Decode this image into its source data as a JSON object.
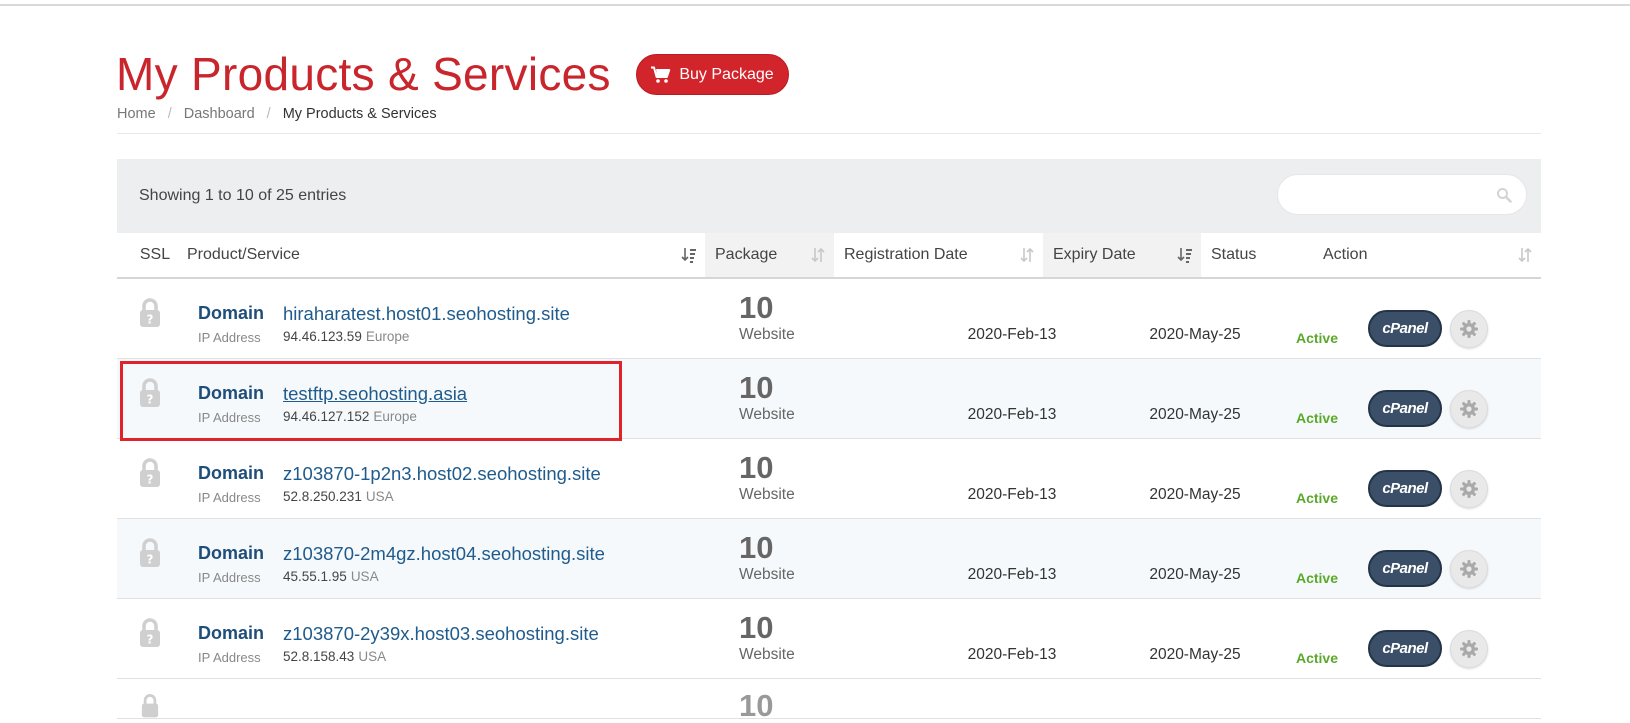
{
  "page": {
    "title": "My Products & Services",
    "buy_button": "Buy Package"
  },
  "breadcrumb": {
    "items": [
      "Home",
      "Dashboard",
      "My Products & Services"
    ],
    "separator": "/"
  },
  "table": {
    "showing_text": "Showing 1 to 10 of 25 entries",
    "search": {
      "value": "",
      "placeholder": ""
    },
    "columns": [
      "SSL",
      "Product/Service",
      "Package",
      "Registration Date",
      "Expiry Date",
      "Status",
      "Action"
    ],
    "rows": [
      {
        "label": "Domain",
        "domain": "hiraharatest.host01.seohosting.site",
        "ip_label": "IP Address",
        "ip": "94.46.123.59",
        "region": "Europe",
        "package_count": "10",
        "package_type": "Website",
        "registration_date": "2020-Feb-13",
        "expiry_date": "2020-May-25",
        "status": "Active",
        "cpanel_label": "cPanel"
      },
      {
        "label": "Domain",
        "domain": "testftp.seohosting.asia",
        "ip_label": "IP Address",
        "ip": "94.46.127.152",
        "region": "Europe",
        "package_count": "10",
        "package_type": "Website",
        "registration_date": "2020-Feb-13",
        "expiry_date": "2020-May-25",
        "status": "Active",
        "cpanel_label": "cPanel"
      },
      {
        "label": "Domain",
        "domain": "z103870-1p2n3.host02.seohosting.site",
        "ip_label": "IP Address",
        "ip": "52.8.250.231",
        "region": "USA",
        "package_count": "10",
        "package_type": "Website",
        "registration_date": "2020-Feb-13",
        "expiry_date": "2020-May-25",
        "status": "Active",
        "cpanel_label": "cPanel"
      },
      {
        "label": "Domain",
        "domain": "z103870-2m4gz.host04.seohosting.site",
        "ip_label": "IP Address",
        "ip": "45.55.1.95",
        "region": "USA",
        "package_count": "10",
        "package_type": "Website",
        "registration_date": "2020-Feb-13",
        "expiry_date": "2020-May-25",
        "status": "Active",
        "cpanel_label": "cPanel"
      },
      {
        "label": "Domain",
        "domain": "z103870-2y39x.host03.seohosting.site",
        "ip_label": "IP Address",
        "ip": "52.8.158.43",
        "region": "USA",
        "package_count": "10",
        "package_type": "Website",
        "registration_date": "2020-Feb-13",
        "expiry_date": "2020-May-25",
        "status": "Active",
        "cpanel_label": "cPanel"
      }
    ]
  },
  "colors": {
    "brand_red": "#d2242b",
    "title_red": "#c9252c",
    "link_blue": "#1f5b8c",
    "status_green": "#5aa92a",
    "cpanel_bg": "#3b5068"
  },
  "icons": [
    "cart-icon",
    "search-icon",
    "sort-icon",
    "lock-icon",
    "gear-icon"
  ]
}
